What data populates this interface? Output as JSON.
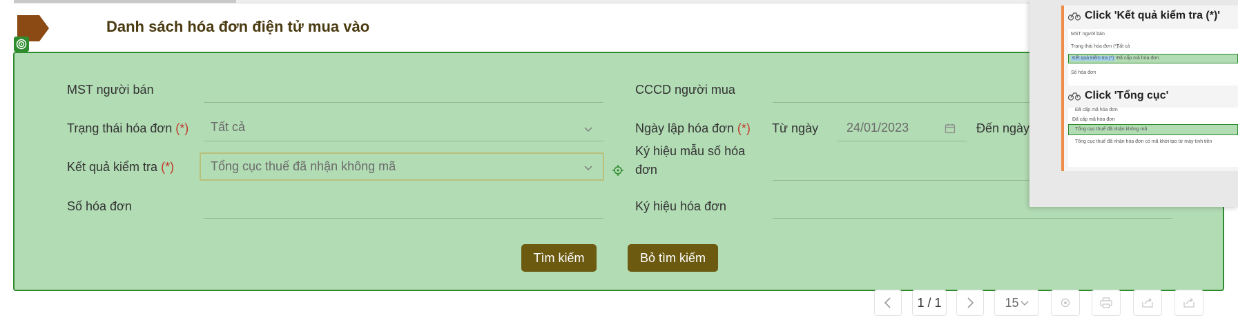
{
  "header": {
    "title": "Danh sách hóa đơn điện tử mua vào"
  },
  "form": {
    "mst_nguoi_ban": {
      "label": "MST người bán",
      "value": ""
    },
    "cccd_nguoi_mua": {
      "label": "CCCD người mua",
      "value": ""
    },
    "trang_thai": {
      "label": "Trạng thái hóa đơn",
      "required": "(*)",
      "value": "Tất cả"
    },
    "ngay_lap": {
      "label": "Ngày lập hóa đơn",
      "required": "(*)",
      "from_label": "Từ ngày",
      "from_value": "24/01/2023",
      "to_label": "Đến ngày"
    },
    "ket_qua": {
      "label": "Kết quả kiểm tra",
      "required": "(*)",
      "value": "Tổng cục thuế đã nhận không mã"
    },
    "ky_hieu_mau": {
      "label_line1": "Ký hiệu mẫu số hóa",
      "label_line2": "đơn",
      "value": ""
    },
    "so_hoa_don": {
      "label": "Số hóa đơn",
      "value": ""
    },
    "ky_hieu_hoa_don": {
      "label": "Ký hiệu hóa đơn",
      "value": ""
    }
  },
  "buttons": {
    "search_label": "Tìm kiếm",
    "clear_label": "Bỏ tìm kiếm"
  },
  "pagination": {
    "page": "1 / 1",
    "page_size": "15"
  },
  "overlay": {
    "step1": {
      "title": "Click 'Kết quả kiểm tra  (*)'",
      "mini_mst": "MST người bán",
      "mini_trang_thai": "Trạng thái hóa đơn (*)",
      "mini_tat_ca": "Tất cả",
      "mini_ket_qua": "Kết quả kiểm tra (*)",
      "mini_da_cap": "Đã cấp mã hóa đơn",
      "mini_so_hoa_don": "Số hóa đơn"
    },
    "step2": {
      "title": "Click 'Tổng cục'",
      "mini_top": "Đã cấp mã hóa đơn",
      "mini_header": "Đã cấp mã hóa đơn",
      "mini_option1": "Tổng cục thuế đã nhận không mã",
      "mini_option2": "Tổng cục thuế đã nhận hóa đơn có mã khởi tạo từ máy tính tiền"
    }
  },
  "colors": {
    "panel_bg": "#b2dcb4",
    "panel_border": "#2e8b2e",
    "button_bg": "#6b5a10",
    "title_color": "#4a3a10",
    "required": "#c0392b",
    "tag_color": "#8b4a14",
    "overlay_accent": "#f08c4a"
  },
  "icons": {
    "title_tag": "pentagon-tag-icon",
    "panel_marker": "target-icon",
    "locate": "crosshair-icon",
    "calendar": "calendar-icon",
    "prev": "chevron-left-icon",
    "next": "chevron-right-icon",
    "settings": "gear-icon",
    "print": "printer-icon",
    "export1": "export-icon",
    "export2": "export-icon",
    "step_icon": "bicycle-icon"
  }
}
